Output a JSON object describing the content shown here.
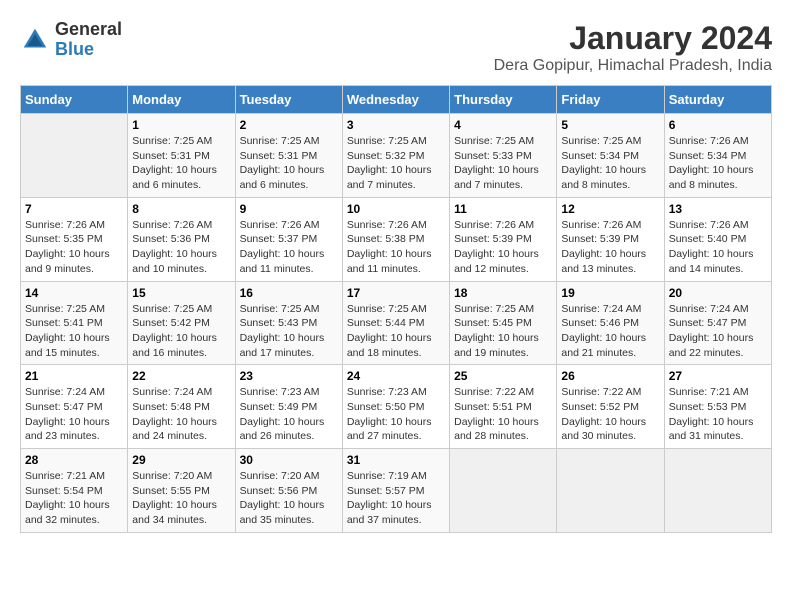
{
  "header": {
    "logo_general": "General",
    "logo_blue": "Blue",
    "title": "January 2024",
    "subtitle": "Dera Gopipur, Himachal Pradesh, India"
  },
  "calendar": {
    "weekdays": [
      "Sunday",
      "Monday",
      "Tuesday",
      "Wednesday",
      "Thursday",
      "Friday",
      "Saturday"
    ],
    "weeks": [
      [
        {
          "num": "",
          "sunrise": "",
          "sunset": "",
          "daylight": "",
          "empty": true
        },
        {
          "num": "1",
          "sunrise": "Sunrise: 7:25 AM",
          "sunset": "Sunset: 5:31 PM",
          "daylight": "Daylight: 10 hours and 6 minutes.",
          "empty": false
        },
        {
          "num": "2",
          "sunrise": "Sunrise: 7:25 AM",
          "sunset": "Sunset: 5:31 PM",
          "daylight": "Daylight: 10 hours and 6 minutes.",
          "empty": false
        },
        {
          "num": "3",
          "sunrise": "Sunrise: 7:25 AM",
          "sunset": "Sunset: 5:32 PM",
          "daylight": "Daylight: 10 hours and 7 minutes.",
          "empty": false
        },
        {
          "num": "4",
          "sunrise": "Sunrise: 7:25 AM",
          "sunset": "Sunset: 5:33 PM",
          "daylight": "Daylight: 10 hours and 7 minutes.",
          "empty": false
        },
        {
          "num": "5",
          "sunrise": "Sunrise: 7:25 AM",
          "sunset": "Sunset: 5:34 PM",
          "daylight": "Daylight: 10 hours and 8 minutes.",
          "empty": false
        },
        {
          "num": "6",
          "sunrise": "Sunrise: 7:26 AM",
          "sunset": "Sunset: 5:34 PM",
          "daylight": "Daylight: 10 hours and 8 minutes.",
          "empty": false
        }
      ],
      [
        {
          "num": "7",
          "sunrise": "Sunrise: 7:26 AM",
          "sunset": "Sunset: 5:35 PM",
          "daylight": "Daylight: 10 hours and 9 minutes.",
          "empty": false
        },
        {
          "num": "8",
          "sunrise": "Sunrise: 7:26 AM",
          "sunset": "Sunset: 5:36 PM",
          "daylight": "Daylight: 10 hours and 10 minutes.",
          "empty": false
        },
        {
          "num": "9",
          "sunrise": "Sunrise: 7:26 AM",
          "sunset": "Sunset: 5:37 PM",
          "daylight": "Daylight: 10 hours and 11 minutes.",
          "empty": false
        },
        {
          "num": "10",
          "sunrise": "Sunrise: 7:26 AM",
          "sunset": "Sunset: 5:38 PM",
          "daylight": "Daylight: 10 hours and 11 minutes.",
          "empty": false
        },
        {
          "num": "11",
          "sunrise": "Sunrise: 7:26 AM",
          "sunset": "Sunset: 5:39 PM",
          "daylight": "Daylight: 10 hours and 12 minutes.",
          "empty": false
        },
        {
          "num": "12",
          "sunrise": "Sunrise: 7:26 AM",
          "sunset": "Sunset: 5:39 PM",
          "daylight": "Daylight: 10 hours and 13 minutes.",
          "empty": false
        },
        {
          "num": "13",
          "sunrise": "Sunrise: 7:26 AM",
          "sunset": "Sunset: 5:40 PM",
          "daylight": "Daylight: 10 hours and 14 minutes.",
          "empty": false
        }
      ],
      [
        {
          "num": "14",
          "sunrise": "Sunrise: 7:25 AM",
          "sunset": "Sunset: 5:41 PM",
          "daylight": "Daylight: 10 hours and 15 minutes.",
          "empty": false
        },
        {
          "num": "15",
          "sunrise": "Sunrise: 7:25 AM",
          "sunset": "Sunset: 5:42 PM",
          "daylight": "Daylight: 10 hours and 16 minutes.",
          "empty": false
        },
        {
          "num": "16",
          "sunrise": "Sunrise: 7:25 AM",
          "sunset": "Sunset: 5:43 PM",
          "daylight": "Daylight: 10 hours and 17 minutes.",
          "empty": false
        },
        {
          "num": "17",
          "sunrise": "Sunrise: 7:25 AM",
          "sunset": "Sunset: 5:44 PM",
          "daylight": "Daylight: 10 hours and 18 minutes.",
          "empty": false
        },
        {
          "num": "18",
          "sunrise": "Sunrise: 7:25 AM",
          "sunset": "Sunset: 5:45 PM",
          "daylight": "Daylight: 10 hours and 19 minutes.",
          "empty": false
        },
        {
          "num": "19",
          "sunrise": "Sunrise: 7:24 AM",
          "sunset": "Sunset: 5:46 PM",
          "daylight": "Daylight: 10 hours and 21 minutes.",
          "empty": false
        },
        {
          "num": "20",
          "sunrise": "Sunrise: 7:24 AM",
          "sunset": "Sunset: 5:47 PM",
          "daylight": "Daylight: 10 hours and 22 minutes.",
          "empty": false
        }
      ],
      [
        {
          "num": "21",
          "sunrise": "Sunrise: 7:24 AM",
          "sunset": "Sunset: 5:47 PM",
          "daylight": "Daylight: 10 hours and 23 minutes.",
          "empty": false
        },
        {
          "num": "22",
          "sunrise": "Sunrise: 7:24 AM",
          "sunset": "Sunset: 5:48 PM",
          "daylight": "Daylight: 10 hours and 24 minutes.",
          "empty": false
        },
        {
          "num": "23",
          "sunrise": "Sunrise: 7:23 AM",
          "sunset": "Sunset: 5:49 PM",
          "daylight": "Daylight: 10 hours and 26 minutes.",
          "empty": false
        },
        {
          "num": "24",
          "sunrise": "Sunrise: 7:23 AM",
          "sunset": "Sunset: 5:50 PM",
          "daylight": "Daylight: 10 hours and 27 minutes.",
          "empty": false
        },
        {
          "num": "25",
          "sunrise": "Sunrise: 7:22 AM",
          "sunset": "Sunset: 5:51 PM",
          "daylight": "Daylight: 10 hours and 28 minutes.",
          "empty": false
        },
        {
          "num": "26",
          "sunrise": "Sunrise: 7:22 AM",
          "sunset": "Sunset: 5:52 PM",
          "daylight": "Daylight: 10 hours and 30 minutes.",
          "empty": false
        },
        {
          "num": "27",
          "sunrise": "Sunrise: 7:21 AM",
          "sunset": "Sunset: 5:53 PM",
          "daylight": "Daylight: 10 hours and 31 minutes.",
          "empty": false
        }
      ],
      [
        {
          "num": "28",
          "sunrise": "Sunrise: 7:21 AM",
          "sunset": "Sunset: 5:54 PM",
          "daylight": "Daylight: 10 hours and 32 minutes.",
          "empty": false
        },
        {
          "num": "29",
          "sunrise": "Sunrise: 7:20 AM",
          "sunset": "Sunset: 5:55 PM",
          "daylight": "Daylight: 10 hours and 34 minutes.",
          "empty": false
        },
        {
          "num": "30",
          "sunrise": "Sunrise: 7:20 AM",
          "sunset": "Sunset: 5:56 PM",
          "daylight": "Daylight: 10 hours and 35 minutes.",
          "empty": false
        },
        {
          "num": "31",
          "sunrise": "Sunrise: 7:19 AM",
          "sunset": "Sunset: 5:57 PM",
          "daylight": "Daylight: 10 hours and 37 minutes.",
          "empty": false
        },
        {
          "num": "",
          "sunrise": "",
          "sunset": "",
          "daylight": "",
          "empty": true
        },
        {
          "num": "",
          "sunrise": "",
          "sunset": "",
          "daylight": "",
          "empty": true
        },
        {
          "num": "",
          "sunrise": "",
          "sunset": "",
          "daylight": "",
          "empty": true
        }
      ]
    ]
  }
}
